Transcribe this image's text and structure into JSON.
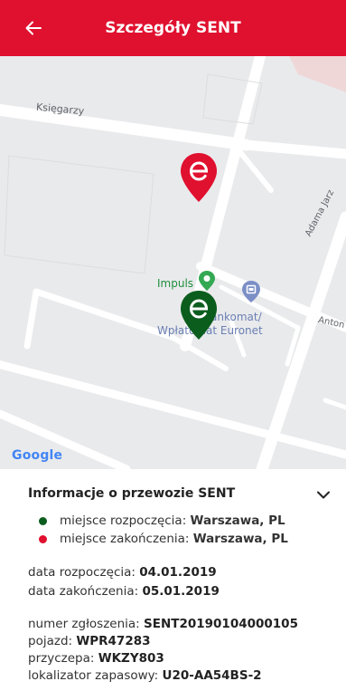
{
  "appbar": {
    "title": "Szczegóły SENT",
    "color": "#e0102f"
  },
  "map": {
    "streets": {
      "ksiegarzy": "Księgarzy",
      "adama": "Adama Jarz",
      "anton": "Anton"
    },
    "pois": {
      "impuls": "Impuls",
      "bankomat_line1": "ankomat/",
      "bankomat_line2": "Wpłatomat Euronet"
    },
    "google_logo": "Google"
  },
  "info": {
    "title": "Informacje o przewozie SENT",
    "start_location": {
      "label": "miejsce rozpoczęcia:",
      "value": "Warszawa, PL",
      "color": "#0b5d1e"
    },
    "end_location": {
      "label": "miejsce zakończenia:",
      "value": "Warszawa, PL",
      "color": "#e0102f"
    },
    "start_date": {
      "label": "data rozpoczęcia:",
      "value": "04.01.2019"
    },
    "end_date": {
      "label": "data zakończenia:",
      "value": "05.01.2019"
    },
    "report_number": {
      "label": "numer zgłoszenia:",
      "value": "SENT20190104000105"
    },
    "vehicle": {
      "label": "pojazd:",
      "value": "WPR47283"
    },
    "trailer": {
      "label": "przyczepa:",
      "value": "WKZY803"
    },
    "backup_locator": {
      "label": "lokalizator zapasowy:",
      "value": "U20-AA54BS-2"
    }
  }
}
